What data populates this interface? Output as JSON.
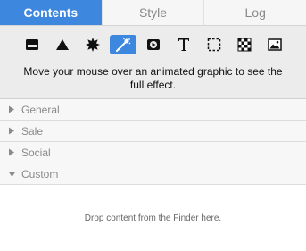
{
  "tabs": [
    {
      "label": "Contents",
      "active": true
    },
    {
      "label": "Style",
      "active": false
    },
    {
      "label": "Log",
      "active": false
    }
  ],
  "toolbar": {
    "selected_tool": "magic-wand-icon",
    "tools": [
      "box-icon",
      "triangle-icon",
      "starburst-icon",
      "magic-wand-icon",
      "video-icon",
      "text-icon",
      "selection-icon",
      "pattern-icon",
      "image-icon"
    ]
  },
  "hint": "Move your mouse over an animated graphic to see the full effect.",
  "sections": [
    {
      "label": "General",
      "expanded": false
    },
    {
      "label": "Sale",
      "expanded": false
    },
    {
      "label": "Social",
      "expanded": false
    },
    {
      "label": "Custom",
      "expanded": true
    }
  ],
  "drop_text": "Drop content from the Finder here.",
  "colors": {
    "accent": "#3d87de"
  }
}
